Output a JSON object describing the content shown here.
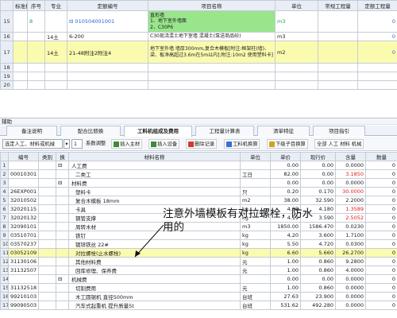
{
  "top_grid": {
    "headers": [
      "标准换",
      "序号",
      "专业",
      "定额编号",
      "项目名称",
      "单位",
      "常规工程量",
      "定额工程量"
    ],
    "rows": [
      {
        "num": "15",
        "seq": "8",
        "major": "",
        "code": "⊟ 010504001001",
        "name": "直形墙\n1、地下室外墙面\n2、C30P6",
        "unit": "m3",
        "qty1": "",
        "qty2": "0"
      },
      {
        "num": "16",
        "seq": "",
        "major": "14土",
        "code": "6-200",
        "name": "C30现浇混土地下室墙 混凝土(泵送商品砼)",
        "unit": "m3",
        "qty1": "",
        "qty2": "0"
      },
      {
        "num": "17",
        "seq": "",
        "major": "14土",
        "code": "21-48附注2附注4",
        "name": "地下室外墙 墙厚300mm,复合木模板[附注:框架柱(墙)、梁、板净高超过3.6m在5m以内];附注:10m2 使用塑料卡]",
        "unit": "m2",
        "qty1": "",
        "qty2": "0"
      },
      {
        "num": "18",
        "seq": "",
        "major": "",
        "code": "",
        "name": "",
        "unit": "",
        "qty1": "",
        "qty2": ""
      },
      {
        "num": "19",
        "seq": "",
        "major": "",
        "code": "",
        "name": "",
        "unit": "",
        "qty1": "",
        "qty2": ""
      },
      {
        "num": "20",
        "seq": "",
        "major": "",
        "code": "",
        "name": "",
        "unit": "",
        "qty1": "",
        "qty2": ""
      }
    ]
  },
  "aux": {
    "title": "辅助",
    "tabs": [
      "备注说明",
      "配合比替换",
      "工料机组成及费用",
      "工程量计算表",
      "清单特征",
      "项目指引"
    ],
    "active_tab": 2
  },
  "toolbar": {
    "select_value": "选定人工、材料或机械",
    "page_value": "1",
    "adjust_label": "系数调整",
    "insert_main": "插入主材",
    "insert_device": "插入设备",
    "delete_record": "删除记录",
    "replace": "工料机换算",
    "download_sub": "下级子目换算",
    "tags": "全部 人工 材料 机械"
  },
  "bottom_grid": {
    "headers": [
      "",
      "编号",
      "类别",
      "换",
      "材料名称",
      "单位",
      "单价",
      "现行价",
      "含量",
      "数量"
    ],
    "rows": [
      {
        "n": "1",
        "code": "",
        "cat": "",
        "sw": "⊟",
        "name": "人工费",
        "unit": "",
        "price": "0.00",
        "cur": "0.00",
        "content": "0.0000",
        "qty": "0"
      },
      {
        "n": "2",
        "code": "00010301",
        "cat": "",
        "sw": "",
        "name": "二类工",
        "unit": "工日",
        "price": "82.00",
        "cur": "0.00",
        "content": "3.1850",
        "qty": "0"
      },
      {
        "n": "3",
        "code": "",
        "cat": "",
        "sw": "⊟",
        "name": "材料费",
        "unit": "",
        "price": "0.00",
        "cur": "0.00",
        "content": "0.0000",
        "qty": "0"
      },
      {
        "n": "4",
        "code": "26EXP001",
        "cat": "",
        "sw": "",
        "name": "塑料卡",
        "unit": "只",
        "price": "0.20",
        "cur": "0.170",
        "content": "30.0000",
        "qty": "0"
      },
      {
        "n": "5",
        "code": "32010502",
        "cat": "",
        "sw": "",
        "name": "复合木模板 18mm",
        "unit": "m2",
        "price": "38.00",
        "cur": "32.590",
        "content": "2.2000",
        "qty": "0"
      },
      {
        "n": "6",
        "code": "32020115",
        "cat": "",
        "sw": "",
        "name": "卡具",
        "unit": "kg",
        "price": "4.88",
        "cur": "4.180",
        "content": "1.3589",
        "qty": "0"
      },
      {
        "n": "7",
        "code": "32020132",
        "cat": "",
        "sw": "",
        "name": "钢管支撑",
        "unit": "kg",
        "price": "4.19",
        "cur": "3.590",
        "content": "2.5052",
        "qty": "0"
      },
      {
        "n": "8",
        "code": "32090101",
        "cat": "",
        "sw": "",
        "name": "周转木材",
        "unit": "m3",
        "price": "1850.00",
        "cur": "1586.470",
        "content": "0.0230",
        "qty": "0"
      },
      {
        "n": "9",
        "code": "03510701",
        "cat": "",
        "sw": "",
        "name": "铁钉",
        "unit": "kg",
        "price": "4.20",
        "cur": "3.600",
        "content": "1.7100",
        "qty": "0"
      },
      {
        "n": "10",
        "code": "03570237",
        "cat": "",
        "sw": "",
        "name": "镀锌铁丝 22#",
        "unit": "kg",
        "price": "5.50",
        "cur": "4.720",
        "content": "0.0300",
        "qty": "0"
      },
      {
        "n": "11",
        "code": "03052109",
        "cat": "",
        "sw": "",
        "name": "对拉螺栓(止水螺栓)",
        "unit": "kg",
        "price": "6.60",
        "cur": "5.660",
        "content": "26.2700",
        "qty": "0"
      },
      {
        "n": "12",
        "code": "31130106",
        "cat": "",
        "sw": "",
        "name": "其他材料费",
        "unit": "元",
        "price": "1.00",
        "cur": "0.860",
        "content": "9.2800",
        "qty": "0"
      },
      {
        "n": "13",
        "code": "31132507",
        "cat": "",
        "sw": "",
        "name": "回库修理、保养费",
        "unit": "元",
        "price": "1.00",
        "cur": "0.860",
        "content": "4.0000",
        "qty": "0"
      },
      {
        "n": "14",
        "code": "",
        "cat": "",
        "sw": "⊟",
        "name": "机械费",
        "unit": "",
        "price": "0.00",
        "cur": "0.00",
        "content": "0.0000",
        "qty": "0"
      },
      {
        "n": "15",
        "code": "31132518",
        "cat": "",
        "sw": "",
        "name": "切割费用",
        "unit": "元",
        "price": "1.00",
        "cur": "0.860",
        "content": "0.0000",
        "qty": "0"
      },
      {
        "n": "16",
        "code": "99210103",
        "cat": "",
        "sw": "",
        "name": "木工圆锯机 直径500mm",
        "unit": "台班",
        "price": "27.63",
        "cur": "23.900",
        "content": "0.0000",
        "qty": "0"
      },
      {
        "n": "17",
        "code": "99090503",
        "cat": "",
        "sw": "",
        "name": "汽车式起重机 提升质量5t",
        "unit": "台班",
        "price": "531.62",
        "cur": "492.280",
        "content": "0.0000",
        "qty": "0"
      }
    ]
  },
  "annotation": "注意外墙模板有对拉螺栓，防水用的"
}
